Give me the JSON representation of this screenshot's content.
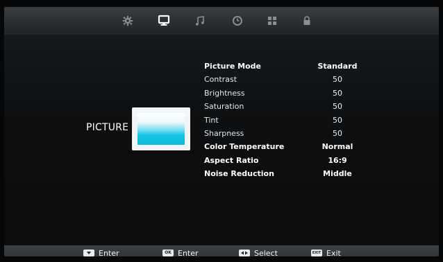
{
  "tabs": [
    {
      "name": "settings-icon",
      "active": false
    },
    {
      "name": "picture-icon",
      "active": true
    },
    {
      "name": "sound-icon",
      "active": false
    },
    {
      "name": "timer-icon",
      "active": false
    },
    {
      "name": "apps-icon",
      "active": false
    },
    {
      "name": "lock-icon",
      "active": false
    }
  ],
  "section": {
    "title": "PICTURE"
  },
  "settings": [
    {
      "label": "Picture Mode",
      "value": "Standard"
    },
    {
      "label": "Contrast",
      "value": "50"
    },
    {
      "label": "Brightness",
      "value": "50"
    },
    {
      "label": "Saturation",
      "value": "50"
    },
    {
      "label": "Tint",
      "value": "50"
    },
    {
      "label": "Sharpness",
      "value": "50"
    },
    {
      "label": "Color Temperature",
      "value": "Normal"
    },
    {
      "label": "Aspect Ratio",
      "value": "16:9"
    },
    {
      "label": "Noise Reduction",
      "value": "Middle"
    }
  ],
  "footer": [
    {
      "key_icon": "down-arrow-key-icon",
      "key_text": "",
      "label": "Enter"
    },
    {
      "key_icon": "ok-key-icon",
      "key_text": "OK",
      "label": "Enter"
    },
    {
      "key_icon": "left-right-key-icon",
      "key_text": "",
      "label": "Select"
    },
    {
      "key_icon": "exit-key-icon",
      "key_text": "EXIT",
      "label": "Exit"
    }
  ],
  "colors": {
    "accent": "#14c3e3",
    "active_icon": "#ffffff",
    "inactive_icon": "#8a8f94"
  }
}
